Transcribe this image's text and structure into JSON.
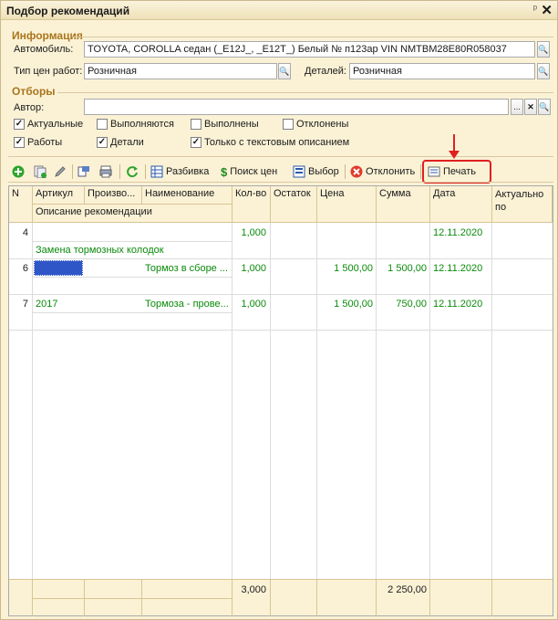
{
  "window": {
    "title": "Подбор рекомендаций",
    "pin_symbol": "ᵖ",
    "close_symbol": "✕"
  },
  "info": {
    "section": "Информация",
    "auto_label": "Автомобиль:",
    "auto_value": "TOYOTA, COROLLA седан (_E12J_, _E12T_) Белый № п123ар VIN NMTBM28E80R058037",
    "price_type_label": "Тип цен работ:",
    "price_type_value": "Розничная",
    "parts_label": "Деталей:",
    "parts_value": "Розничная"
  },
  "filters": {
    "section": "Отборы",
    "author_label": "Автор:",
    "author_value": "",
    "checkboxes": [
      {
        "label": "Актуальные",
        "checked": true
      },
      {
        "label": "Выполняются",
        "checked": false
      },
      {
        "label": "Выполнены",
        "checked": false
      },
      {
        "label": "Отклонены",
        "checked": false
      },
      {
        "label": "Работы",
        "checked": true
      },
      {
        "label": "Детали",
        "checked": true
      },
      {
        "label": "Только с текстовым описанием",
        "checked": true
      }
    ]
  },
  "toolbar": {
    "split": "Разбивка",
    "price_search": "Поиск цен",
    "select": "Выбор",
    "reject": "Отклонить",
    "print": "Печать"
  },
  "table": {
    "headers": {
      "n": "N",
      "article": "Артикул",
      "maker": "Произво...",
      "name": "Наименование",
      "qty": "Кол-во",
      "rest": "Остаток",
      "price": "Цена",
      "sum": "Сумма",
      "date": "Дата",
      "actual": "Актуально по",
      "desc": "Описание рекомендации"
    },
    "rows": [
      {
        "n": "4",
        "article": "",
        "maker": "",
        "name": "",
        "qty": "1,000",
        "rest": "",
        "price": "",
        "sum": "",
        "date": "12.11.2020",
        "actual": "",
        "desc": "Замена тормозных колодок"
      },
      {
        "n": "6",
        "article": "",
        "maker": "",
        "name": "Тормоз в сборе ...",
        "qty": "1,000",
        "rest": "",
        "price": "1 500,00",
        "sum": "1 500,00",
        "date": "12.11.2020",
        "actual": "",
        "desc": ""
      },
      {
        "n": "7",
        "article": "2017",
        "maker": "",
        "name": "Тормоза - прове...",
        "qty": "1,000",
        "rest": "",
        "price": "1 500,00",
        "sum": "750,00",
        "date": "12.11.2020",
        "actual": "",
        "desc": ""
      }
    ],
    "footer": {
      "qty_total": "3,000",
      "sum_total": "2 250,00"
    }
  }
}
